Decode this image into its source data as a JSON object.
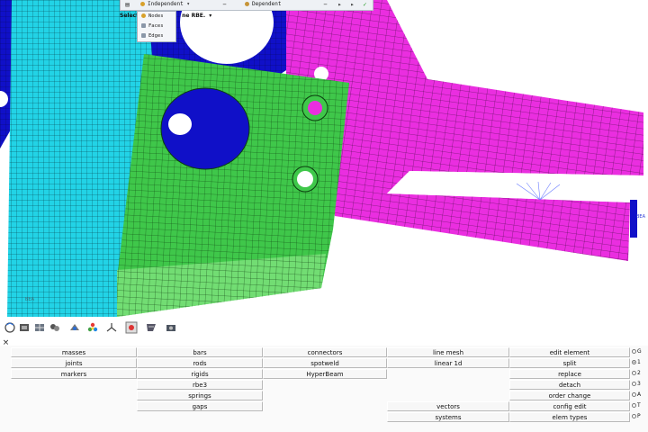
{
  "toolbar": {
    "independent_label": "Independent",
    "dependent_label": "Dependent",
    "minimize": "−",
    "next": "▸",
    "expand": "▸",
    "confirm": "✓"
  },
  "selection": {
    "prefix": "Select",
    "suffix": "ne RBE."
  },
  "dropdown": {
    "items": [
      "Nodes",
      "Faces",
      "Edges"
    ],
    "active_index": 0
  },
  "viewport": {
    "label_bottom_left": "BEA",
    "label_right": "BEA"
  },
  "panel": {
    "columns": [
      [
        "masses",
        "joints",
        "markers"
      ],
      [
        "bars",
        "rods",
        "rigids",
        "rbe3",
        "springs",
        "gaps"
      ],
      [
        "connectors",
        "spotweld",
        "HyperBeam"
      ],
      [
        "line mesh",
        "linear 1d",
        "",
        "",
        "",
        "vectors",
        "systems"
      ],
      [
        "edit element",
        "split",
        "replace",
        "detach",
        "order change",
        "config edit",
        "elem types"
      ]
    ],
    "radios": [
      {
        "label": "G",
        "selected": false
      },
      {
        "label": "1",
        "selected": true
      },
      {
        "label": "2",
        "selected": false
      },
      {
        "label": "3",
        "selected": false
      },
      {
        "label": "A",
        "selected": false
      },
      {
        "label": "T",
        "selected": false
      },
      {
        "label": "P",
        "selected": false
      }
    ]
  },
  "colors": {
    "cyan_part": "#22d3e6",
    "green_part": "#3fc74a",
    "light_green_part": "#7be07a",
    "magenta_part": "#ea2ee0",
    "blue_part": "#1010c8",
    "mesh_line": "#0a3a0a",
    "accent_rbe": "#6a7cff"
  }
}
